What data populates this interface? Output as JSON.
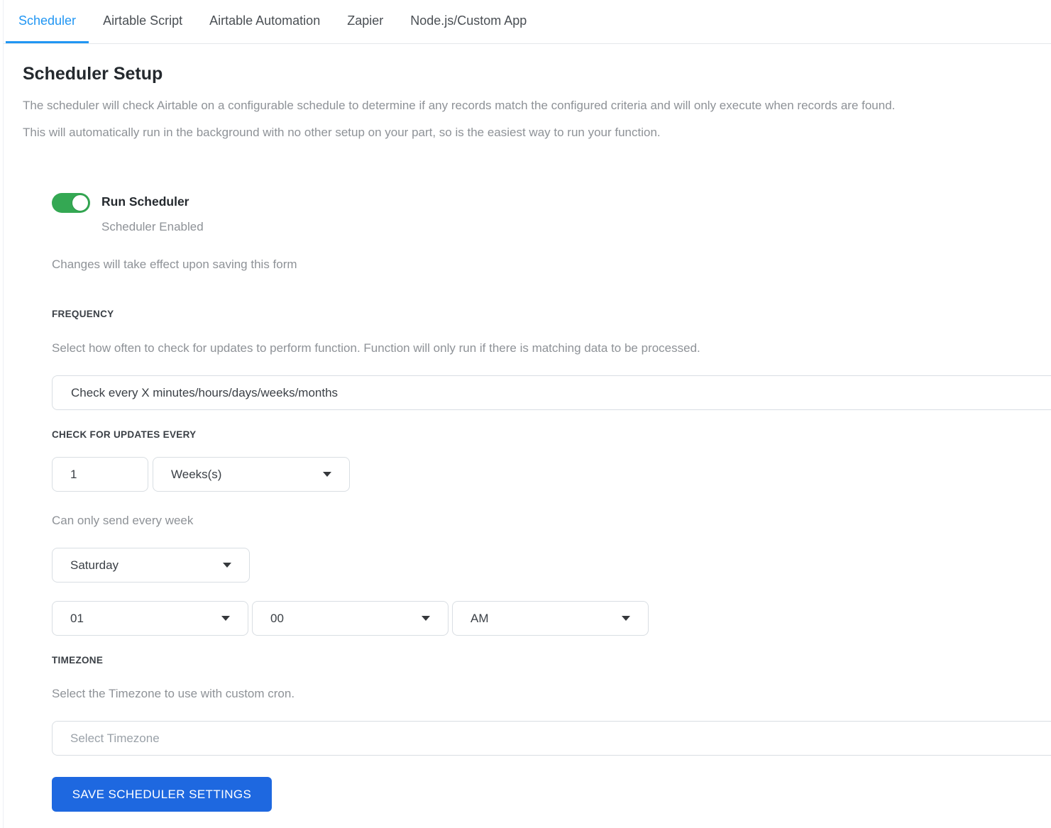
{
  "tabs": [
    {
      "label": "Scheduler",
      "active": true
    },
    {
      "label": "Airtable Script",
      "active": false
    },
    {
      "label": "Airtable Automation",
      "active": false
    },
    {
      "label": "Zapier",
      "active": false
    },
    {
      "label": "Node.js/Custom App",
      "active": false
    }
  ],
  "header": {
    "title": "Scheduler Setup",
    "description_line1": "The scheduler will check Airtable on a configurable schedule to determine if any records match the configured criteria and will only execute when records are found.",
    "description_line2": "This will automatically run in the background with no other setup on your part, so is the easiest way to run your function."
  },
  "scheduler_toggle": {
    "label": "Run Scheduler",
    "status": "Scheduler Enabled",
    "enabled": true,
    "note": "Changes will take effect upon saving this form"
  },
  "frequency": {
    "section_label": "FREQUENCY",
    "help": "Select how often to check for updates to perform function. Function will only run if there is matching data to be processed.",
    "mode_value": "Check every X minutes/hours/days/weeks/months",
    "check_every_label": "CHECK FOR UPDATES EVERY",
    "interval_value": "1",
    "unit_value": "Weeks(s)",
    "note": "Can only send every week",
    "day_value": "Saturday",
    "hour_value": "01",
    "minute_value": "00",
    "meridiem_value": "AM"
  },
  "timezone": {
    "section_label": "TIMEZONE",
    "help": "Select the Timezone to use with custom cron.",
    "placeholder": "Select Timezone"
  },
  "actions": {
    "save_label": "SAVE SCHEDULER SETTINGS"
  },
  "colors": {
    "accent_blue": "#2196f3",
    "button_blue": "#1e68e0",
    "toggle_green": "#34a853",
    "border_gray": "#d9dee3",
    "text_dark": "#24292e",
    "text_gray": "#8e9297"
  }
}
